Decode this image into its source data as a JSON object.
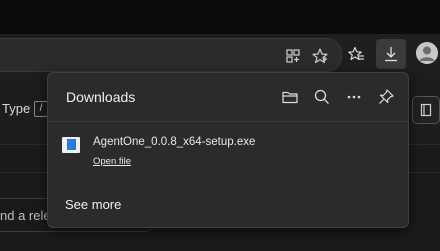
{
  "downloads_panel": {
    "title": "Downloads",
    "header_buttons": [
      "open-folder-icon",
      "search-icon",
      "more-options-icon",
      "pin-icon"
    ],
    "items": [
      {
        "file_name": "AgentOne_0.0.8_x64-setup.exe",
        "action_label": "Open file",
        "icon": "installer-file-icon"
      }
    ],
    "see_more_label": "See more"
  },
  "toolbar": {
    "icons": [
      "app-available-icon",
      "favorite-star-icon",
      "favorites-icon",
      "downloads-icon",
      "profile-avatar-icon"
    ]
  },
  "page_behind": {
    "type_filter_label": "Type",
    "type_filter_key": "/",
    "input_partial_text": "nd a rele"
  },
  "colors": {
    "flyout_bg": "#2b2b2b",
    "toolbar_bg": "#1f1f1f",
    "active_button_bg": "#3b3b3b",
    "file_icon_accent": "#2a7be0"
  }
}
